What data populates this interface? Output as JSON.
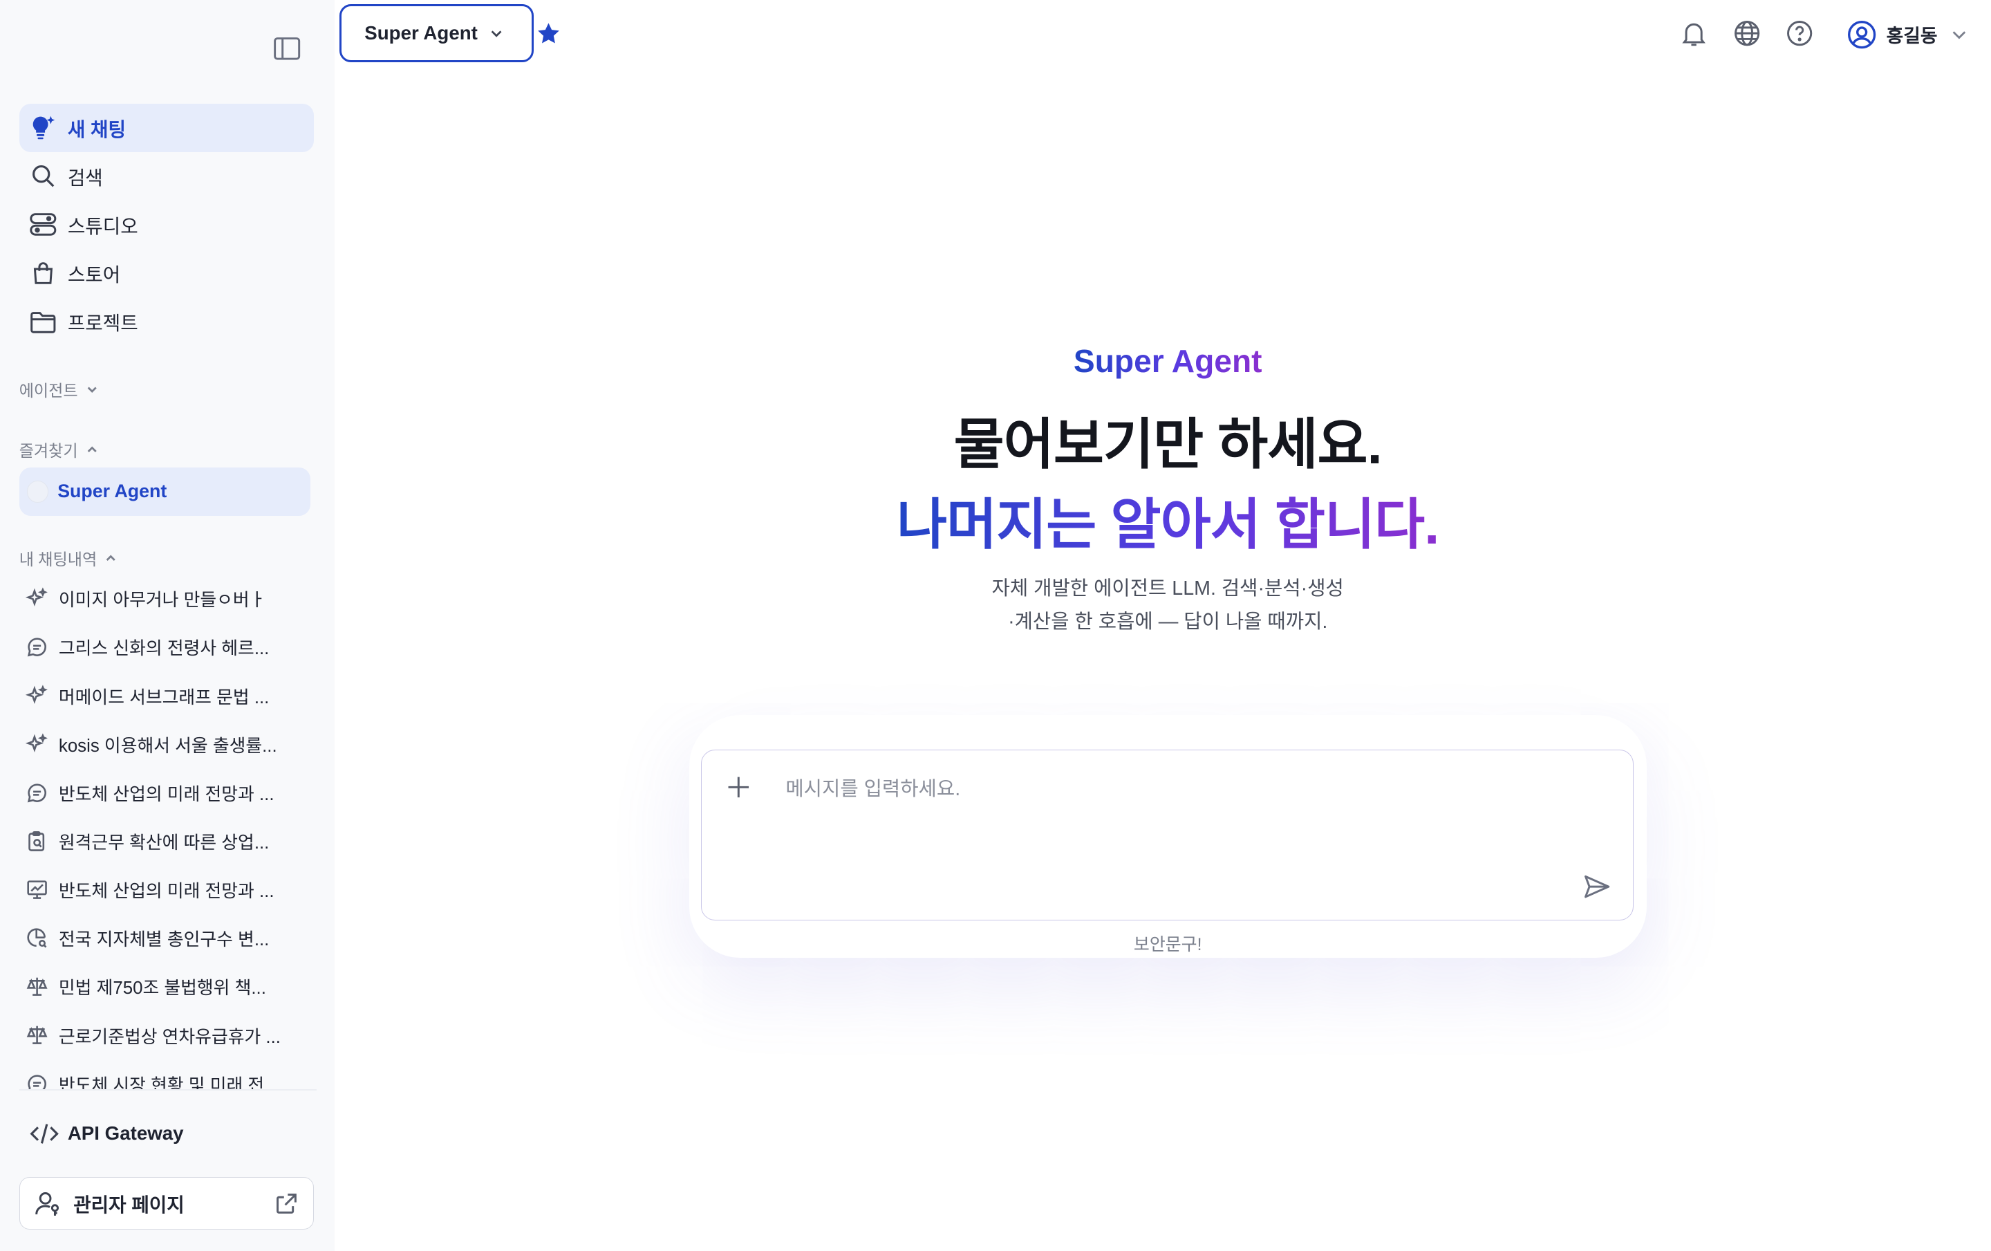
{
  "sidebar": {
    "nav": [
      {
        "label": "새 채팅",
        "icon": "new-chat-icon",
        "active": true
      },
      {
        "label": "검색",
        "icon": "search-icon"
      },
      {
        "label": "스튜디오",
        "icon": "studio-icon"
      },
      {
        "label": "스토어",
        "icon": "store-bag-icon"
      },
      {
        "label": "프로젝트",
        "icon": "folder-icon"
      }
    ],
    "agents_section": "에이전트",
    "favorites_section": "즐겨찾기",
    "favorites": [
      {
        "label": "Super Agent"
      }
    ],
    "history_section": "내 채팅내역",
    "history": [
      {
        "label": "이미지 아무거나 만들ㅇ버ㅏ",
        "icon": "sparkle-icon"
      },
      {
        "label": "그리스 신화의 전령사 헤르...",
        "icon": "chat-bubble-icon"
      },
      {
        "label": "머메이드 서브그래프 문법 ...",
        "icon": "sparkle-icon"
      },
      {
        "label": "kosis 이용해서 서울 출생률...",
        "icon": "sparkle-icon"
      },
      {
        "label": "반도체 산업의 미래 전망과 ...",
        "icon": "chat-bubble-icon"
      },
      {
        "label": "원격근무 확산에 따른 상업...",
        "icon": "clipboard-search-icon"
      },
      {
        "label": "반도체 산업의 미래 전망과 ...",
        "icon": "chart-presentation-icon"
      },
      {
        "label": "전국 지자체별 총인구수 변...",
        "icon": "chart-search-icon"
      },
      {
        "label": "민법 제750조 불법행위 책...",
        "icon": "scale-icon"
      },
      {
        "label": "근로기준법상 연차유급휴가 ...",
        "icon": "scale-icon"
      },
      {
        "label": "반도체 시장 현황 및 미래 전...",
        "icon": "chat-bubble-icon"
      }
    ],
    "api_gateway": "API Gateway",
    "admin_page": "관리자 페이지"
  },
  "topbar": {
    "agent_select": "Super Agent",
    "user_name": "홍길동"
  },
  "hero": {
    "brand": "Super Agent",
    "headline_1": "물어보기만 하세요.",
    "headline_2": "나머지는 알아서 합니다.",
    "desc_1": "자체 개발한 에이전트 LLM. 검색·분석·생성",
    "desc_2": "·계산을 한 호흡에 — 답이 나올 때까지."
  },
  "composer": {
    "placeholder": "메시지를 입력하세요.",
    "value": ""
  },
  "security_notice": "보안문구!",
  "colors": {
    "accent": "#2145c6",
    "accent_purple": "#8a2fcf",
    "active_bg": "#e6ecfb",
    "sidebar_bg": "#f8f9fb"
  }
}
